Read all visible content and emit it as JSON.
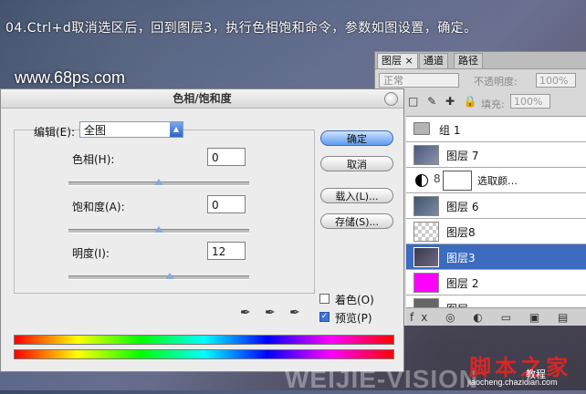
{
  "overlay": {
    "instruction": "04.Ctrl+d取消选区后，回到图层3，执行色相饱和命令，参数如图设置，确定。",
    "site": "www.68ps.com",
    "watermark": "WEIJIE-VISION",
    "logo_title": "脚本之家",
    "logo_sub": "jiaocheng.chazidian.com",
    "logo_mid": "教程"
  },
  "layers_panel": {
    "tabs": [
      "图层",
      "通道",
      "路径"
    ],
    "tab_close": "×",
    "blend_mode": "正常",
    "opacity_label": "不透明度:",
    "opacity_value": "100%",
    "lock_icons": "□ ✎ ✚ 🔒",
    "fill_label": "填充:",
    "fill_value": "100%",
    "group_name": "组 1",
    "layers": [
      {
        "name": "图层 7",
        "thumb_color": "#4a5c7a"
      },
      {
        "name": "选取颜…",
        "type": "adjustment"
      },
      {
        "name": "图层 6",
        "thumb_color": "#3f566c"
      },
      {
        "name": "图层8",
        "thumb_color": "checker"
      },
      {
        "name": "图层3",
        "thumb_color": "#4b4658",
        "selected": true
      },
      {
        "name": "图层 2",
        "thumb_color": "#ff00ff"
      },
      {
        "name": "图层…",
        "thumb_color": "#666666"
      }
    ],
    "footer_icons": "fx ◎ ◐ ▭ ▣ ▤"
  },
  "dialog": {
    "title": "色相/饱和度",
    "edit_label": "编辑(E):",
    "edit_value": "全图",
    "hue_label": "色相(H):",
    "hue_value": "0",
    "sat_label": "饱和度(A):",
    "sat_value": "0",
    "light_label": "明度(I):",
    "light_value": "12",
    "hue_pos": 0.5,
    "sat_pos": 0.5,
    "light_pos": 0.56,
    "buttons": {
      "ok": "确定",
      "cancel": "取消",
      "load": "载入(L)...",
      "save": "存储(S)..."
    },
    "colorize_label": "着色(O)",
    "colorize_checked": false,
    "preview_label": "预览(P)",
    "preview_checked": true,
    "eyedroppers": [
      "✒",
      "✒",
      "✒"
    ]
  }
}
